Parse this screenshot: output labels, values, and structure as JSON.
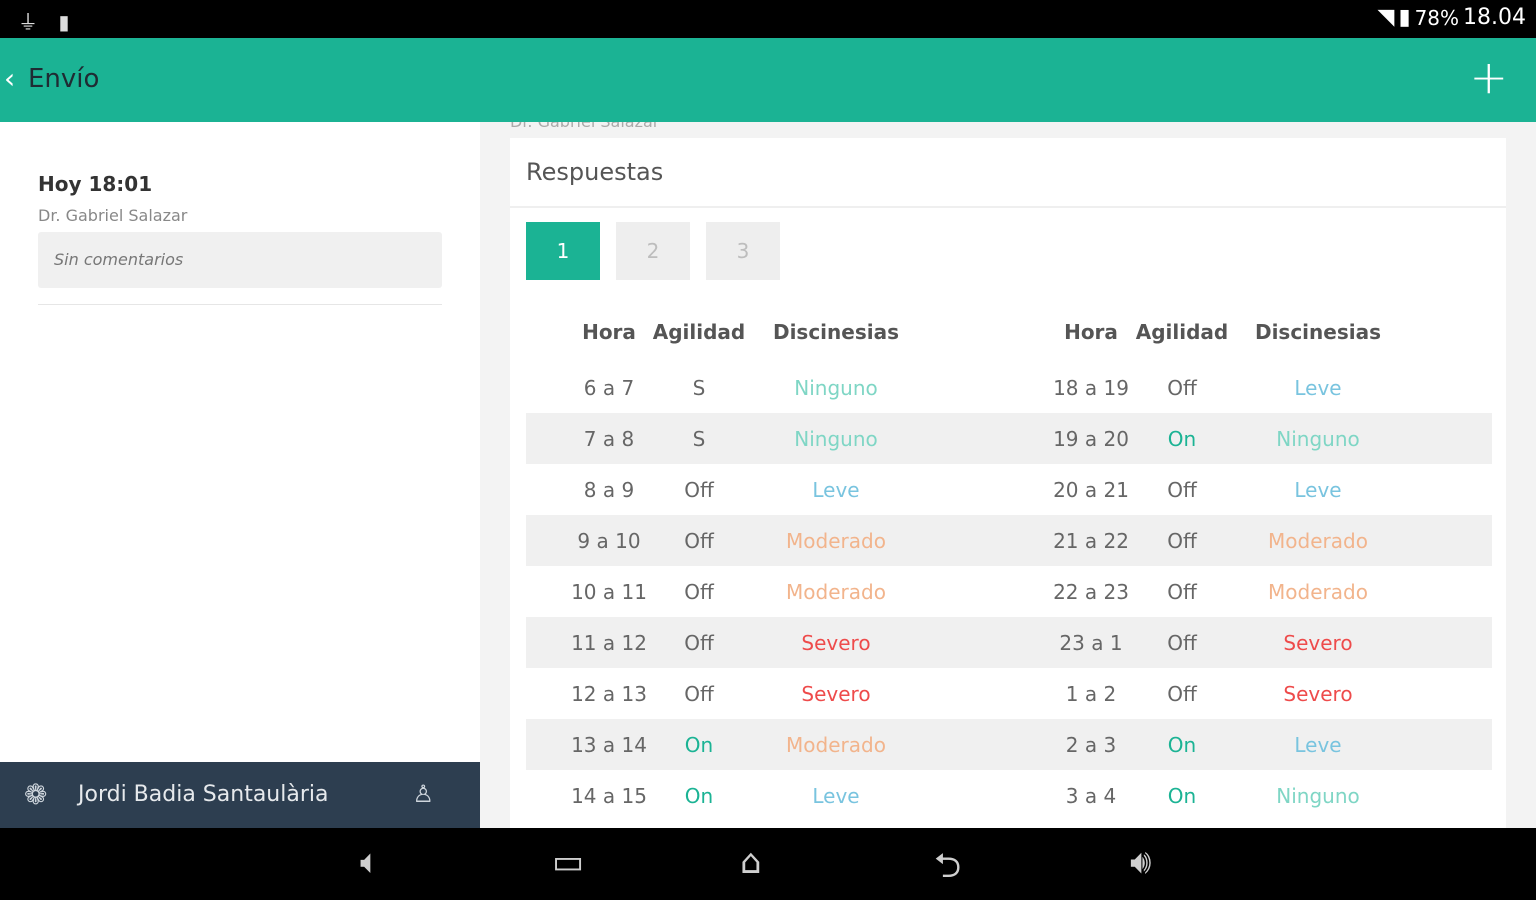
{
  "status_bar": {
    "left_icons": [
      "usb-icon",
      "sd-card-icon"
    ],
    "battery": "78%",
    "time": "18.04"
  },
  "app_bar": {
    "title": "Envío"
  },
  "left_panel": {
    "time": "Hoy 18:01",
    "doctor": "Dr. Gabriel Salazar",
    "comments": "Sin comentarios",
    "user_name": "Jordi Badia Santaulària"
  },
  "responses": {
    "partially_cut_text": "Dr. Gabriel Salazar",
    "title": "Respuestas",
    "tabs": [
      "1",
      "2",
      "3"
    ],
    "active_tab": "1",
    "columns": [
      "Hora",
      "Agilidad",
      "Discinesias"
    ],
    "colors": {
      "Ninguno": "#7fd6c5",
      "Leve": "#79c4df",
      "Moderado": "#f2b48c",
      "Severo": "#ee4b4b",
      "On": "#1bb394",
      "default": "#666666"
    },
    "left_rows": [
      {
        "hora": "6 a 7",
        "agilidad": "S",
        "discinesias": "Ninguno"
      },
      {
        "hora": "7 a 8",
        "agilidad": "S",
        "discinesias": "Ninguno"
      },
      {
        "hora": "8 a 9",
        "agilidad": "Off",
        "discinesias": "Leve"
      },
      {
        "hora": "9 a 10",
        "agilidad": "Off",
        "discinesias": "Moderado"
      },
      {
        "hora": "10 a 11",
        "agilidad": "Off",
        "discinesias": "Moderado"
      },
      {
        "hora": "11 a 12",
        "agilidad": "Off",
        "discinesias": "Severo"
      },
      {
        "hora": "12 a 13",
        "agilidad": "Off",
        "discinesias": "Severo"
      },
      {
        "hora": "13 a 14",
        "agilidad": "On",
        "discinesias": "Moderado"
      },
      {
        "hora": "14 a 15",
        "agilidad": "On",
        "discinesias": "Leve"
      }
    ],
    "right_rows": [
      {
        "hora": "18 a 19",
        "agilidad": "Off",
        "discinesias": "Leve"
      },
      {
        "hora": "19 a 20",
        "agilidad": "On",
        "discinesias": "Ninguno"
      },
      {
        "hora": "20 a 21",
        "agilidad": "Off",
        "discinesias": "Leve"
      },
      {
        "hora": "21 a 22",
        "agilidad": "Off",
        "discinesias": "Moderado"
      },
      {
        "hora": "22 a 23",
        "agilidad": "Off",
        "discinesias": "Moderado"
      },
      {
        "hora": "23 a 1",
        "agilidad": "Off",
        "discinesias": "Severo"
      },
      {
        "hora": "1 a 2",
        "agilidad": "Off",
        "discinesias": "Severo"
      },
      {
        "hora": "2 a 3",
        "agilidad": "On",
        "discinesias": "Leve"
      },
      {
        "hora": "3 a 4",
        "agilidad": "On",
        "discinesias": "Ninguno"
      }
    ]
  },
  "nav_bar": {
    "icons": [
      "volume-down-icon",
      "recent-apps-icon",
      "home-icon",
      "back-icon",
      "volume-up-icon"
    ]
  }
}
